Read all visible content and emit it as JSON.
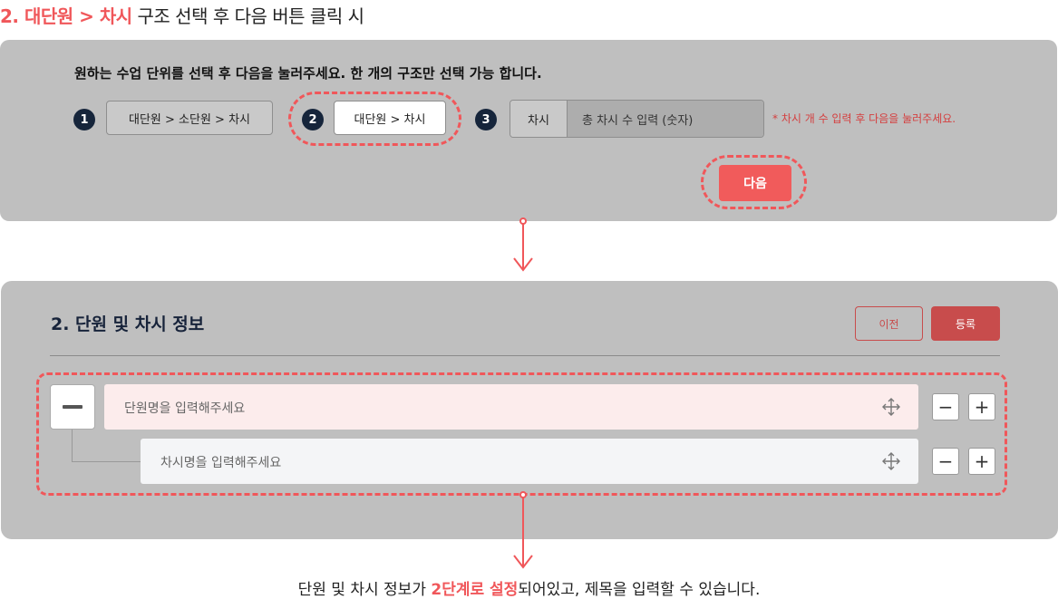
{
  "heading": {
    "highlight": "2. 대단원 > 차시",
    "rest": " 구조 선택 후 다음 버튼 클릭 시"
  },
  "step1": {
    "instruction": "원하는 수업 단위를 선택 후 다음을 눌러주세요. 한 개의 구조만 선택 가능 합니다.",
    "options": [
      {
        "number": "1",
        "label": "대단원 > 소단원 > 차시"
      },
      {
        "number": "2",
        "label": "대단원 > 차시",
        "selected": true
      },
      {
        "number": "3",
        "label": "차시"
      }
    ],
    "count_placeholder": "총 차시 수 입력 (숫자)",
    "note": "* 차시 개 수 입력 후 다음을 눌러주세요.",
    "next_label": "다음"
  },
  "step2": {
    "title": "2. 단원 및 차시 정보",
    "prev_label": "이전",
    "register_label": "등록",
    "unit_placeholder": "단원명을 입력해주세요",
    "lesson_placeholder": "차시명을 입력해주세요",
    "minus_symbol": "−",
    "plus_symbol": "+"
  },
  "caption": {
    "before": "단원 및 차시 정보가 ",
    "highlight": "2단계로 설정",
    "after": "되어있고, 제목을 입력할 수 있습니다."
  },
  "colors": {
    "accent": "#f0575a",
    "panel": "#bfbfbf",
    "dark_badge": "#16253b",
    "register": "#c84c4c"
  }
}
